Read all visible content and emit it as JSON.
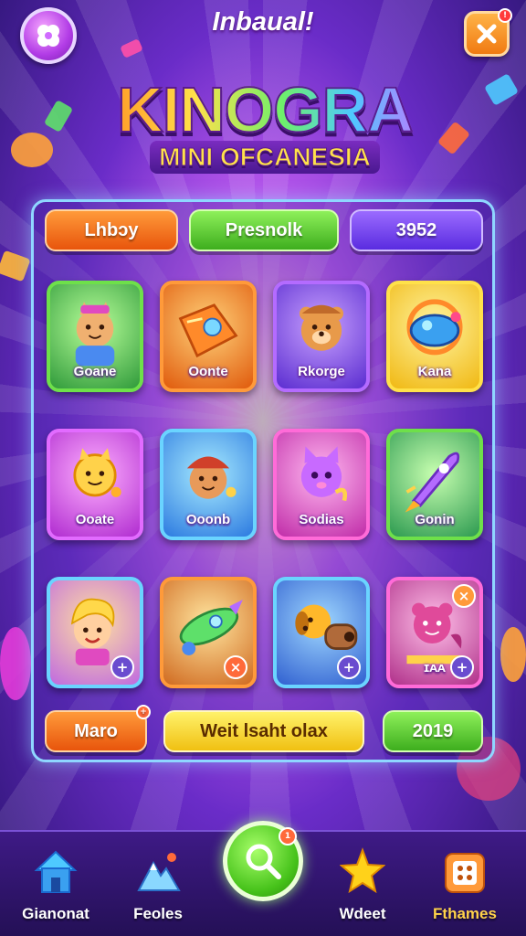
{
  "header": {
    "title": "Inbaual!",
    "close_badge": "!"
  },
  "logo": {
    "title": "KINOGRA",
    "subtitle": "MINI OFCANESIA"
  },
  "panel": {
    "top_pills": [
      {
        "label": "Lhbɔy",
        "color": "orange"
      },
      {
        "label": "Presnolk",
        "color": "green"
      },
      {
        "label": "3952",
        "color": "purple"
      }
    ],
    "tiles": [
      {
        "label": "Goane",
        "border": "#6ee04a",
        "bg": [
          "#b9ff9a",
          "#2f9a3a"
        ],
        "character": "cat-kid"
      },
      {
        "label": "Oonte",
        "border": "#ff9a3a",
        "bg": [
          "#ffd27a",
          "#e05a0c"
        ],
        "character": "orange-gem"
      },
      {
        "label": "Rkorge",
        "border": "#b46bff",
        "bg": [
          "#c9a2ff",
          "#5a2cd0"
        ],
        "character": "bear-cub"
      },
      {
        "label": "Kana",
        "border": "#ffe14a",
        "bg": [
          "#fff4a0",
          "#f0b812"
        ],
        "character": "blue-ring-ship"
      },
      {
        "label": "Ooate",
        "border": "#e26bff",
        "bg": [
          "#ffb0ff",
          "#b02cd0"
        ],
        "character": "sun-cat"
      },
      {
        "label": "Ooonb",
        "border": "#6ad4ff",
        "bg": [
          "#a8ecff",
          "#2c7ae0"
        ],
        "character": "bear-hat"
      },
      {
        "label": "Sodias",
        "border": "#ff6bd8",
        "bg": [
          "#ffb8f0",
          "#c02ca8"
        ],
        "character": "purple-cat"
      },
      {
        "label": "Gonin",
        "border": "#6ee04a",
        "bg": [
          "#c8ffb0",
          "#2c9a50"
        ],
        "character": "purple-rocket"
      },
      {
        "label": "",
        "border": "#6ad4ff",
        "bg": [
          "#ffe0a0",
          "#c06ae0"
        ],
        "character": "blonde-boy",
        "badge": "+"
      },
      {
        "label": "",
        "border": "#ff9a3a",
        "bg": [
          "#ffe6a0",
          "#d06a20"
        ],
        "character": "green-rocket",
        "badge": "x"
      },
      {
        "label": "",
        "border": "#6ad4ff",
        "bg": [
          "#a0d8ff",
          "#3060d0"
        ],
        "character": "dog-cannon",
        "badge": "+"
      },
      {
        "label": "ɪᴀᴀ",
        "border": "#ff6bd8",
        "bg": [
          "#ffc0e8",
          "#b0308a"
        ],
        "character": "pink-bear",
        "badge": "+",
        "corner_badge": "x"
      }
    ],
    "bottom_pills": [
      {
        "label": "Maro",
        "color": "orange",
        "badge": "+"
      },
      {
        "label": "Weit lsaht olax",
        "color": "yellow"
      },
      {
        "label": "2019",
        "color": "green"
      }
    ]
  },
  "bottom_nav": {
    "items": [
      {
        "label": "Gianonat",
        "icon": "home-icon"
      },
      {
        "label": "Feoles",
        "icon": "mountain-icon"
      },
      {
        "label": "",
        "icon": "search-icon",
        "badge": "1"
      },
      {
        "label": "Wdeet",
        "icon": "star-icon"
      },
      {
        "label": "Fthames",
        "icon": "puzzle-icon"
      }
    ]
  },
  "colors": {
    "accent_orange": "#f07a12",
    "accent_green": "#46c21a",
    "accent_purple": "#6a2cc8",
    "panel_border": "#8fd6ff"
  }
}
